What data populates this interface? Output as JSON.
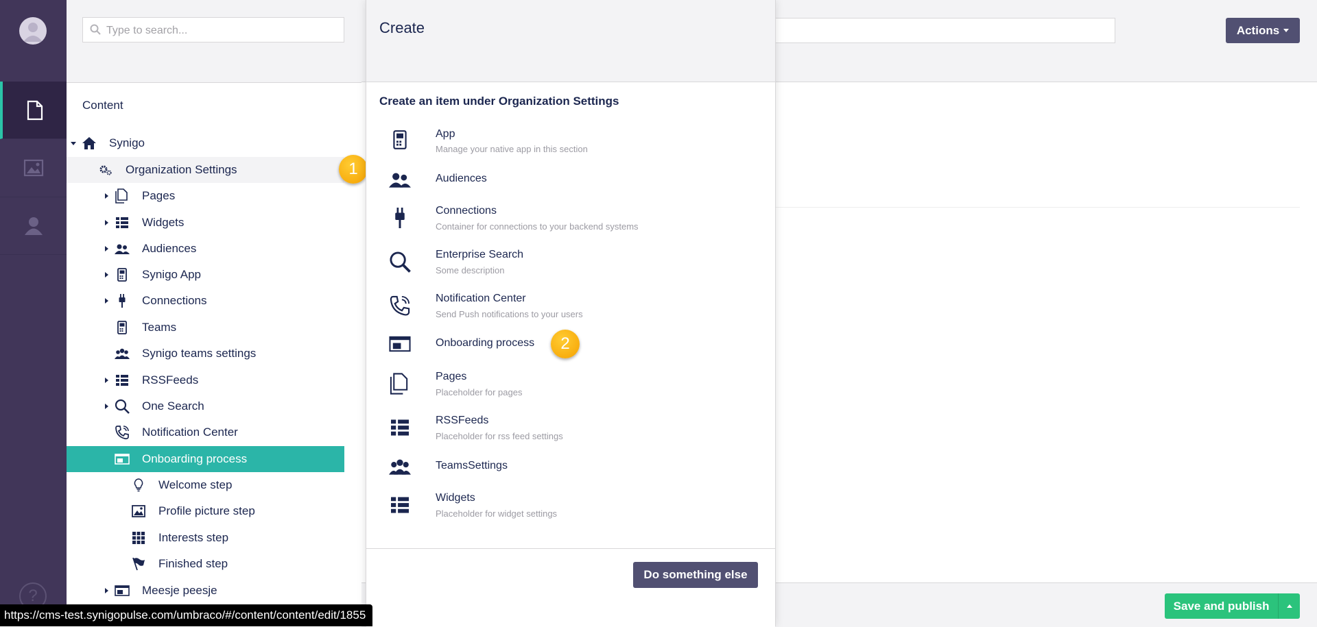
{
  "rail": {
    "items": [
      "content-icon",
      "media-icon",
      "members-icon"
    ],
    "help_glyph": "?"
  },
  "tree": {
    "search_placeholder": "Type to search...",
    "section_title": "Content",
    "root": "Synigo",
    "org_settings": "Organization Settings",
    "more_glyph": "•••",
    "children": [
      "Pages",
      "Widgets",
      "Audiences",
      "Synigo App",
      "Connections",
      "Teams",
      "Synigo teams settings",
      "RSSFeeds",
      "One Search",
      "Notification Center",
      "Onboarding process"
    ],
    "onboarding_children": [
      "Welcome step",
      "Profile picture step",
      "Interests step",
      "Finished step"
    ],
    "last_item": "Meesje peesje"
  },
  "badges": {
    "one": "1",
    "two": "2"
  },
  "main": {
    "actions_label": "Actions",
    "save_label": "Save and publish"
  },
  "dialog": {
    "title": "Create",
    "subtitle": "Create an item under Organization Settings",
    "items": [
      {
        "name": "App",
        "desc": "Manage your native app in this section",
        "icon": "mobile-icon"
      },
      {
        "name": "Audiences",
        "desc": "",
        "icon": "users-icon"
      },
      {
        "name": "Connections",
        "desc": "Container for connections to your backend systems",
        "icon": "plug-icon"
      },
      {
        "name": "Enterprise Search",
        "desc": "Some description",
        "icon": "search-icon"
      },
      {
        "name": "Notification Center",
        "desc": "Send Push notifications to your users",
        "icon": "phone-ring-icon"
      },
      {
        "name": "Onboarding process",
        "desc": "",
        "icon": "screens-icon"
      },
      {
        "name": "Pages",
        "desc": "Placeholder for pages",
        "icon": "documents-icon"
      },
      {
        "name": "RSSFeeds",
        "desc": "Placeholder for rss feed settings",
        "icon": "list-icon"
      },
      {
        "name": "TeamsSettings",
        "desc": "",
        "icon": "users-icon"
      },
      {
        "name": "Widgets",
        "desc": "Placeholder for widget settings",
        "icon": "list-icon"
      }
    ],
    "other_button": "Do something else"
  },
  "status": {
    "url": "https://cms-test.synigopulse.com/umbraco/#/content/content/edit/1855"
  },
  "colors": {
    "rail": "#413659",
    "selected": "#2bb5a8",
    "save": "#2bc37c",
    "button": "#515072",
    "badge": "#f5a100"
  }
}
